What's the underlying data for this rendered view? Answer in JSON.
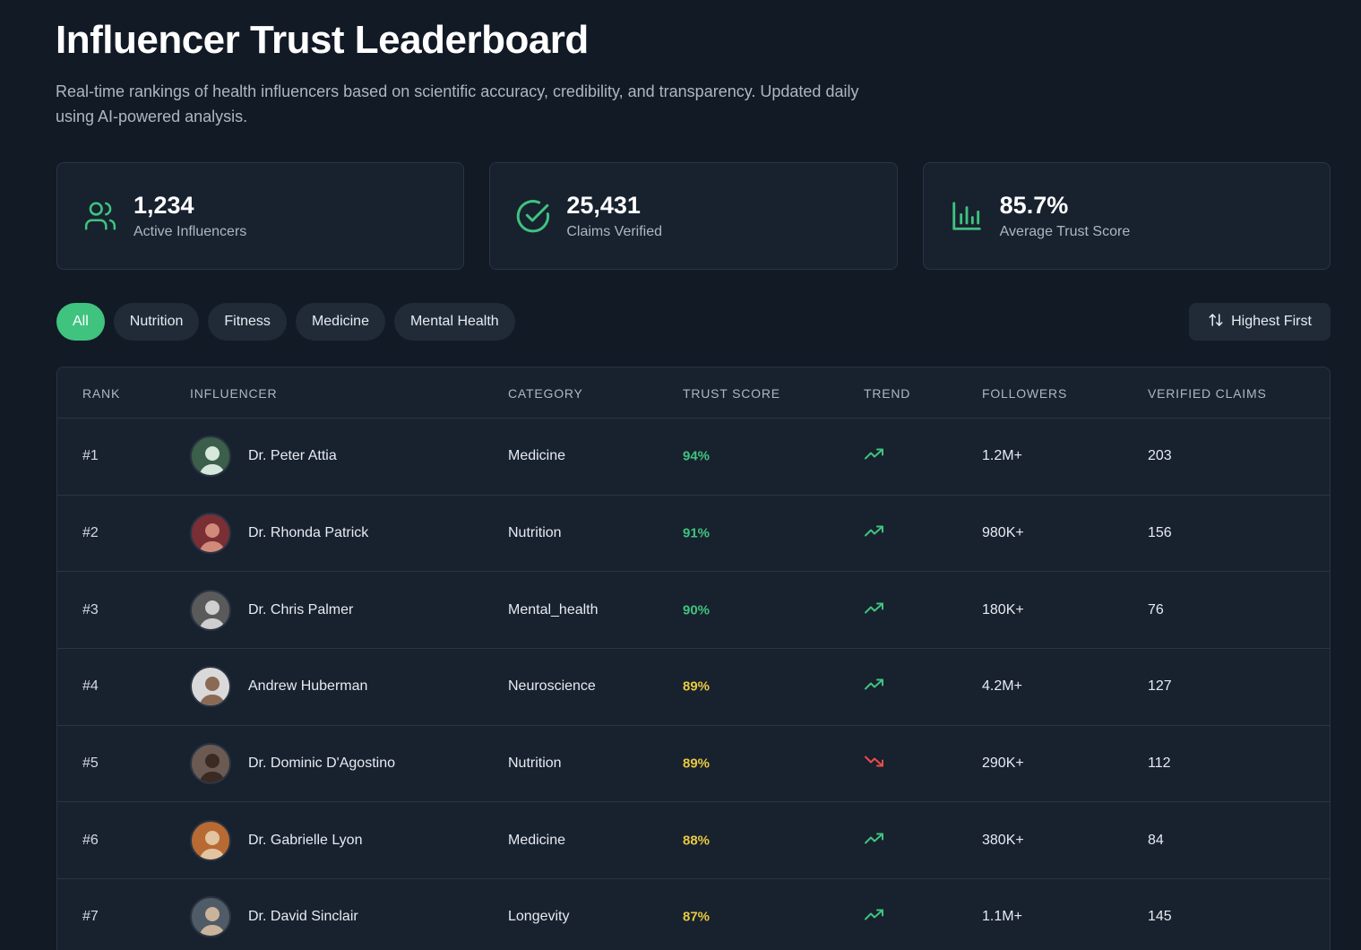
{
  "header": {
    "title": "Influencer Trust Leaderboard",
    "subtitle": "Real-time rankings of health influencers based on scientific accuracy, credibility, and transparency. Updated daily using AI-powered analysis."
  },
  "stats": [
    {
      "value": "1,234",
      "label": "Active Influencers",
      "icon": "users-icon"
    },
    {
      "value": "25,431",
      "label": "Claims Verified",
      "icon": "check-circle-icon"
    },
    {
      "value": "85.7%",
      "label": "Average Trust Score",
      "icon": "bar-chart-icon"
    }
  ],
  "filters": {
    "chips": [
      "All",
      "Nutrition",
      "Fitness",
      "Medicine",
      "Mental Health"
    ],
    "active": "All",
    "sort_label": "Highest First"
  },
  "table": {
    "headers": [
      "RANK",
      "INFLUENCER",
      "CATEGORY",
      "TRUST SCORE",
      "TREND",
      "FOLLOWERS",
      "VERIFIED CLAIMS"
    ],
    "rows": [
      {
        "rank": "#1",
        "name": "Dr. Peter Attia",
        "category": "Medicine",
        "score": "94%",
        "trend": "up",
        "followers": "1.2M+",
        "claims": "203"
      },
      {
        "rank": "#2",
        "name": "Dr. Rhonda Patrick",
        "category": "Nutrition",
        "score": "91%",
        "trend": "up",
        "followers": "980K+",
        "claims": "156"
      },
      {
        "rank": "#3",
        "name": "Dr. Chris Palmer",
        "category": "Mental_health",
        "score": "90%",
        "trend": "up",
        "followers": "180K+",
        "claims": "76"
      },
      {
        "rank": "#4",
        "name": "Andrew Huberman",
        "category": "Neuroscience",
        "score": "89%",
        "trend": "up",
        "followers": "4.2M+",
        "claims": "127"
      },
      {
        "rank": "#5",
        "name": "Dr. Dominic D'Agostino",
        "category": "Nutrition",
        "score": "89%",
        "trend": "down",
        "followers": "290K+",
        "claims": "112"
      },
      {
        "rank": "#6",
        "name": "Dr. Gabrielle Lyon",
        "category": "Medicine",
        "score": "88%",
        "trend": "up",
        "followers": "380K+",
        "claims": "84"
      },
      {
        "rank": "#7",
        "name": "Dr. David Sinclair",
        "category": "Longevity",
        "score": "87%",
        "trend": "up",
        "followers": "1.1M+",
        "claims": "145"
      }
    ]
  },
  "colors": {
    "accent": "#3fc37f",
    "score_high": "#3fc37f",
    "score_mid": "#e7c93f",
    "trend_up": "#3fc37f",
    "trend_down": "#ef4b4b"
  }
}
